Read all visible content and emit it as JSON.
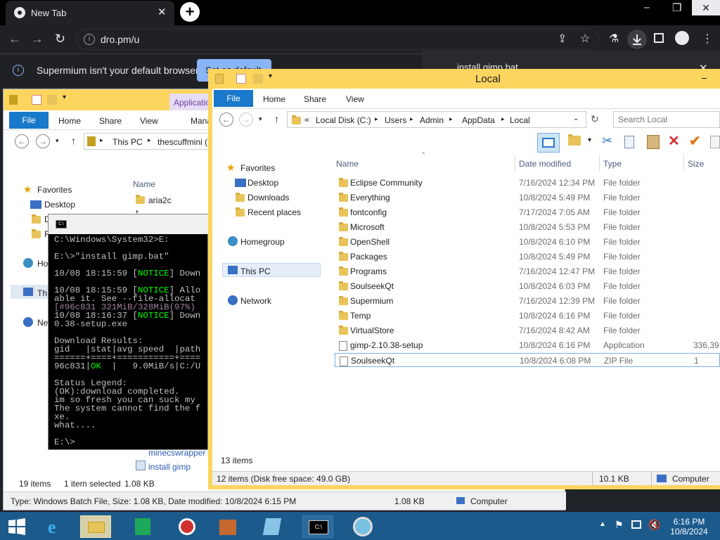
{
  "browser": {
    "tab_title": "New Tab",
    "tab_close": "✕",
    "new_tab": "+",
    "url": "dro.pm/u",
    "minimize": "⎯",
    "restore": "❐",
    "close": "✕",
    "infobar_text": "Supermium isn't your default browser",
    "infobar_button": "Set as default",
    "download_popup": "install gimp.bat"
  },
  "back_explorer": {
    "ribbon_tabs": [
      "File",
      "Home",
      "Share",
      "View"
    ],
    "context_tab": "Application",
    "context_sub": "Mana",
    "breadcrumb": [
      "This PC",
      "thescuffmini ("
    ],
    "nav_favorites": "Favorites",
    "nav_desktop": "Desktop",
    "nav_d": "D",
    "nav_r": "R",
    "nav_ho": "Ho",
    "nav_th": "Th",
    "nav_ne": "Ne",
    "col_name": "Name",
    "file_aria": "aria2c",
    "file_wrapper": "minecswrapper",
    "file_install": "install gimp",
    "status_items": "19 items",
    "status_selected": "1 item selected",
    "status_size": "1.08 KB",
    "bottom_info": "Type: Windows Batch File, Size: 1.08 KB, Date modified: 10/8/2024 6:15 PM",
    "bottom_size": "1.08 KB",
    "bottom_computer": "Computer"
  },
  "cmd": {
    "lines": [
      "C:\\Windows\\System32>E:",
      "",
      "E:\\>\"install gimp.bat\"",
      "",
      "10/08 18:15:59 [NOTICE] Down",
      "",
      "10/08 18:15:59 [NOTICE] Allo",
      "able it. See --file-allocat",
      "[#96c831 321MiB/328MiB(97%)",
      "10/08 18:16:37 [NOTICE] Down",
      "0.38-setup.exe",
      "",
      "Download Results:",
      "gid   |stat|avg speed  |path",
      "======+====+===========+====",
      "96c831|OK  |   9.0MiB/s|C:/U",
      "",
      "Status Legend:",
      "(OK):download completed.",
      "im so fresh you can suck my",
      "The system cannot find the f",
      "xe.",
      "what....",
      "",
      "E:\\>"
    ]
  },
  "explorer": {
    "title": "Local",
    "ribbon_tabs": [
      "File",
      "Home",
      "Share",
      "View"
    ],
    "breadcrumb": [
      "«",
      "Local Disk (C:)",
      "Users",
      "Admin",
      "AppData",
      "Local"
    ],
    "search_placeholder": "Search Local",
    "nav": {
      "favorites": "Favorites",
      "desktop": "Desktop",
      "downloads": "Downloads",
      "recent": "Recent places",
      "homegroup": "Homegroup",
      "thispc": "This PC",
      "network": "Network"
    },
    "columns": [
      "Name",
      "Date modified",
      "Type",
      "Size"
    ],
    "rows": [
      {
        "name": "Eclipse Community",
        "date": "7/16/2024 12:34 PM",
        "type": "File folder",
        "size": ""
      },
      {
        "name": "Everything",
        "date": "10/8/2024 5:49 PM",
        "type": "File folder",
        "size": ""
      },
      {
        "name": "fontconfig",
        "date": "7/17/2024 7:05 AM",
        "type": "File folder",
        "size": ""
      },
      {
        "name": "Microsoft",
        "date": "10/8/2024 5:53 PM",
        "type": "File folder",
        "size": ""
      },
      {
        "name": "OpenShell",
        "date": "10/8/2024 6:10 PM",
        "type": "File folder",
        "size": ""
      },
      {
        "name": "Packages",
        "date": "10/8/2024 5:49 PM",
        "type": "File folder",
        "size": ""
      },
      {
        "name": "Programs",
        "date": "7/16/2024 12:47 PM",
        "type": "File folder",
        "size": ""
      },
      {
        "name": "SoulseekQt",
        "date": "10/8/2024 6:03 PM",
        "type": "File folder",
        "size": ""
      },
      {
        "name": "Supermium",
        "date": "7/16/2024 12:39 PM",
        "type": "File folder",
        "size": ""
      },
      {
        "name": "Temp",
        "date": "10/8/2024 6:16 PM",
        "type": "File folder",
        "size": ""
      },
      {
        "name": "VirtualStore",
        "date": "7/16/2024 8:42 AM",
        "type": "File folder",
        "size": ""
      },
      {
        "name": "gimp-2.10.38-setup",
        "date": "10/8/2024 6:16 PM",
        "type": "Application",
        "size": "336,39"
      },
      {
        "name": "SoulseekQt",
        "date": "10/8/2024 6:08 PM",
        "type": "ZIP File",
        "size": "1"
      }
    ],
    "items_count": "13 items",
    "status_left": "12 items (Disk free space: 49.0 GB)",
    "status_size": "10.1 KB",
    "status_computer": "Computer"
  },
  "taskbar": {
    "time": "6:16 PM",
    "date": "10/8/2024"
  },
  "colors": {
    "titlebar": "#fcd55f",
    "file_tab": "#1979ca",
    "taskbar": "#1c5a8c",
    "chrome_dark": "#202124"
  }
}
